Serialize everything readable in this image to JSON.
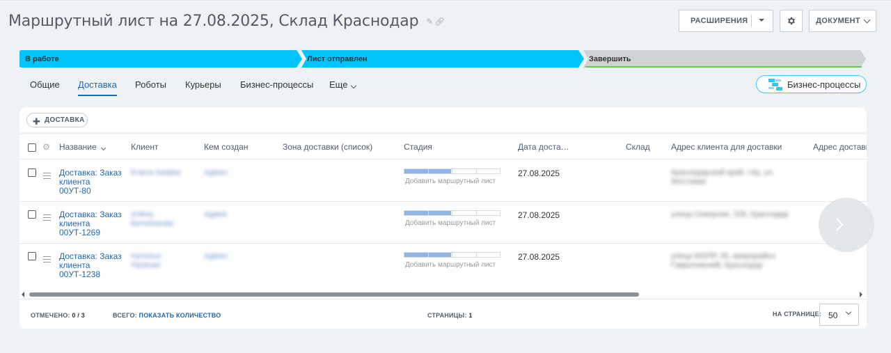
{
  "header": {
    "title": "Маршрутный лист на 27.08.2025, Склад Краснодар",
    "extensions_label": "РАСШИРЕНИЯ",
    "document_label": "ДОКУМЕНТ",
    "icons": {
      "edit": "pencil-icon",
      "link": "link-icon",
      "settings": "gear-icon"
    }
  },
  "stages": [
    {
      "label": "В работе",
      "color": "#00c4fb"
    },
    {
      "label": "Лист отправлен",
      "color": "#00c4fb"
    },
    {
      "label": "Завершить",
      "color": "#cfd2d6"
    }
  ],
  "tabs": [
    {
      "label": "Общие",
      "active": false
    },
    {
      "label": "Доставка",
      "active": true
    },
    {
      "label": "Роботы",
      "active": false
    },
    {
      "label": "Курьеры",
      "active": false
    },
    {
      "label": "Бизнес-процессы",
      "active": false
    },
    {
      "label": "Еще",
      "active": false
    }
  ],
  "bp_button": {
    "label": "Бизнес-процессы"
  },
  "toolbar": {
    "add_label": "ДОСТАВКА"
  },
  "grid": {
    "columns": [
      "Название",
      "Клиент",
      "Кем создан",
      "Зона доставки (список)",
      "Стадия",
      "Дата доста…",
      "Склад",
      "Адрес клиента для доставки",
      "Адрес доставк"
    ],
    "progress_label": "Добавить маршрутный лист",
    "rows": [
      {
        "title": "Доставка: Заказ клиента 00УТ-80",
        "client": "Елена Акаёва",
        "creator": "Админ",
        "date": "27.08.2025",
        "stage_progress": 0.49,
        "address": "Краснодарский край, г.Кр, ул. Мостовая"
      },
      {
        "title": "Доставка: Заказ клиента 00УТ-1269",
        "client": "Алёна Белобокова",
        "creator": "Админ",
        "date": "27.08.2025",
        "stage_progress": 0.49,
        "address": "улица Северная, 328, Краснодар"
      },
      {
        "title": "Доставка: Заказ клиента 00УТ-1238",
        "client": "Наталья Лапенко",
        "creator": "Админ",
        "date": "27.08.2025",
        "stage_progress": 0.49,
        "address": "улица МОПР, 35, микрорайон Гавриловский, Краснодар"
      }
    ]
  },
  "footer": {
    "checked_label": "ОТМЕЧЕНО:",
    "checked_value": "0 / 3",
    "total_label": "ВСЕГО:",
    "total_link": "ПОКАЗАТЬ КОЛИЧЕСТВО",
    "pages_label": "СТРАНИЦЫ:",
    "pages_value": "1",
    "per_page_label": "НА СТРАНИЦЕ:",
    "per_page_value": "50"
  }
}
